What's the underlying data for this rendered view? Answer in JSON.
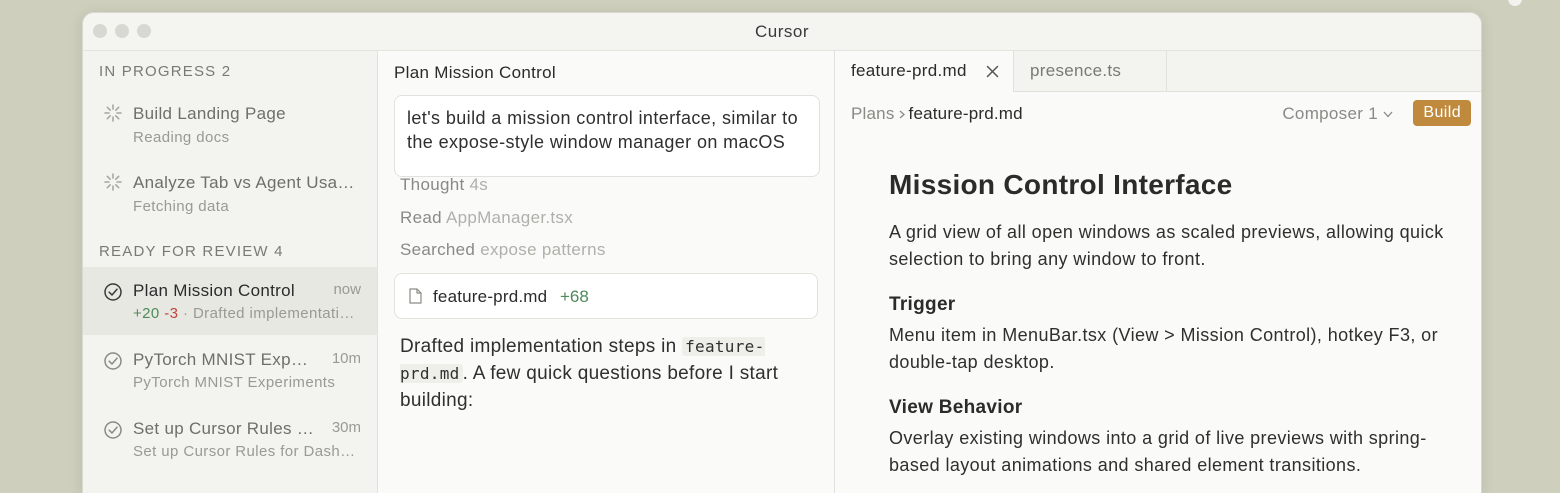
{
  "window": {
    "title": "Cursor"
  },
  "sidebar": {
    "in_progress_heading": "IN PROGRESS 2",
    "ready_heading": "READY FOR REVIEW 4",
    "in_progress": [
      {
        "title": "Build Landing Page",
        "subtitle": "Reading docs"
      },
      {
        "title": "Analyze Tab vs Agent Usage Patterns",
        "subtitle": "Fetching data"
      }
    ],
    "review": [
      {
        "title": "Plan Mission Control",
        "time": "now",
        "plus": "+20",
        "minus": "-3",
        "sep": "·",
        "detail": "Drafted implementation steps in feature-prd.md"
      },
      {
        "title": "PyTorch MNIST Experiments",
        "time": "10m",
        "subtitle": "PyTorch MNIST Experiments"
      },
      {
        "title": "Set up Cursor Rules for Dashboard",
        "time": "30m",
        "subtitle": "Set up Cursor Rules for Dashboard"
      }
    ]
  },
  "chat": {
    "title": "Plan Mission Control",
    "prompt": "let's build a mission control interface, similar to the expose-style window manager on macOS",
    "steps": [
      {
        "label": "Thought",
        "detail": "4s"
      },
      {
        "label": "Read",
        "detail": "AppManager.tsx"
      },
      {
        "label": "Searched",
        "detail": "expose patterns"
      }
    ],
    "file_chip": {
      "name": "feature-prd.md",
      "diff": "+68"
    },
    "reply_before": "Drafted implementation steps in ",
    "reply_code": "feature-prd.md",
    "reply_after": ". A few quick questions before I start building:"
  },
  "editor": {
    "tabs": [
      {
        "label": "feature-prd.md"
      },
      {
        "label": "presence.ts"
      }
    ],
    "breadcrumb": {
      "root": "Plans",
      "current": "feature-prd.md"
    },
    "composer_label": "Composer 1",
    "build_label": "Build",
    "doc": {
      "h1": "Mission Control Interface",
      "intro": "A grid view of all open windows as scaled previews, allowing quick selection to bring any window to front.",
      "sections": [
        {
          "heading": "Trigger",
          "body": "Menu item in MenuBar.tsx (View > Mission Control), hotkey F3, or double-tap desktop."
        },
        {
          "heading": "View Behavior",
          "body": "Overlay existing windows into a grid of live previews with spring-based layout animations and shared element transitions."
        }
      ]
    }
  }
}
